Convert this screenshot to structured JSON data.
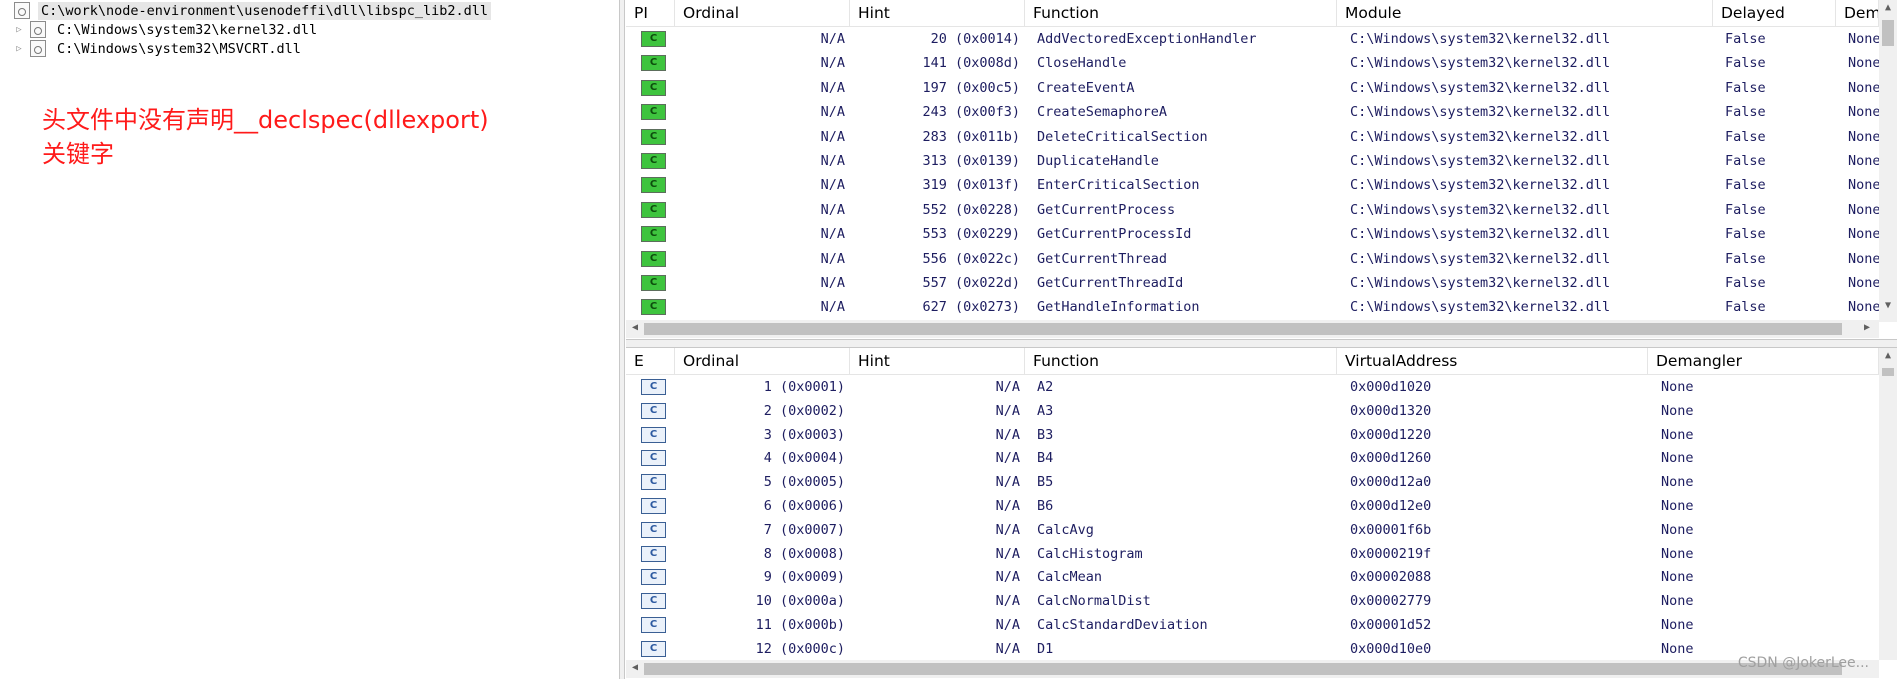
{
  "tree": {
    "items": [
      {
        "label": "C:\\work\\node-environment\\usenodeffi\\dll\\libspc_lib2.dll",
        "selected": true,
        "expander": ""
      },
      {
        "label": "C:\\Windows\\system32\\kernel32.dll",
        "selected": false,
        "expander": "▷"
      },
      {
        "label": "C:\\Windows\\system32\\MSVCRT.dll",
        "selected": false,
        "expander": "▷"
      }
    ]
  },
  "note": {
    "line1": "头文件中没有声明__declspec(dllexport)",
    "line2": "关键字"
  },
  "imports": {
    "columns": [
      "PI",
      "Ordinal",
      "Hint",
      "Function",
      "Module",
      "Delayed",
      "Dem"
    ],
    "icon_label": "C",
    "rows": [
      {
        "ordinal": "N/A",
        "hint": "20 (0x0014)",
        "function": "AddVectoredExceptionHandler",
        "module": "C:\\Windows\\system32\\kernel32.dll",
        "delayed": "False",
        "dem": "None"
      },
      {
        "ordinal": "N/A",
        "hint": "141 (0x008d)",
        "function": "CloseHandle",
        "module": "C:\\Windows\\system32\\kernel32.dll",
        "delayed": "False",
        "dem": "None"
      },
      {
        "ordinal": "N/A",
        "hint": "197 (0x00c5)",
        "function": "CreateEventA",
        "module": "C:\\Windows\\system32\\kernel32.dll",
        "delayed": "False",
        "dem": "None"
      },
      {
        "ordinal": "N/A",
        "hint": "243 (0x00f3)",
        "function": "CreateSemaphoreA",
        "module": "C:\\Windows\\system32\\kernel32.dll",
        "delayed": "False",
        "dem": "None"
      },
      {
        "ordinal": "N/A",
        "hint": "283 (0x011b)",
        "function": "DeleteCriticalSection",
        "module": "C:\\Windows\\system32\\kernel32.dll",
        "delayed": "False",
        "dem": "None"
      },
      {
        "ordinal": "N/A",
        "hint": "313 (0x0139)",
        "function": "DuplicateHandle",
        "module": "C:\\Windows\\system32\\kernel32.dll",
        "delayed": "False",
        "dem": "None"
      },
      {
        "ordinal": "N/A",
        "hint": "319 (0x013f)",
        "function": "EnterCriticalSection",
        "module": "C:\\Windows\\system32\\kernel32.dll",
        "delayed": "False",
        "dem": "None"
      },
      {
        "ordinal": "N/A",
        "hint": "552 (0x0228)",
        "function": "GetCurrentProcess",
        "module": "C:\\Windows\\system32\\kernel32.dll",
        "delayed": "False",
        "dem": "None"
      },
      {
        "ordinal": "N/A",
        "hint": "553 (0x0229)",
        "function": "GetCurrentProcessId",
        "module": "C:\\Windows\\system32\\kernel32.dll",
        "delayed": "False",
        "dem": "None"
      },
      {
        "ordinal": "N/A",
        "hint": "556 (0x022c)",
        "function": "GetCurrentThread",
        "module": "C:\\Windows\\system32\\kernel32.dll",
        "delayed": "False",
        "dem": "None"
      },
      {
        "ordinal": "N/A",
        "hint": "557 (0x022d)",
        "function": "GetCurrentThreadId",
        "module": "C:\\Windows\\system32\\kernel32.dll",
        "delayed": "False",
        "dem": "None"
      },
      {
        "ordinal": "N/A",
        "hint": "627 (0x0273)",
        "function": "GetHandleInformation",
        "module": "C:\\Windows\\system32\\kernel32.dll",
        "delayed": "False",
        "dem": "None"
      }
    ]
  },
  "exports": {
    "columns": [
      "E",
      "Ordinal",
      "Hint",
      "Function",
      "VirtualAddress",
      "Demangler"
    ],
    "icon_label": "C",
    "rows": [
      {
        "ordinal": "1 (0x0001)",
        "hint": "N/A",
        "function": "A2",
        "va": "0x000d1020",
        "dem": "None"
      },
      {
        "ordinal": "2 (0x0002)",
        "hint": "N/A",
        "function": "A3",
        "va": "0x000d1320",
        "dem": "None"
      },
      {
        "ordinal": "3 (0x0003)",
        "hint": "N/A",
        "function": "B3",
        "va": "0x000d1220",
        "dem": "None"
      },
      {
        "ordinal": "4 (0x0004)",
        "hint": "N/A",
        "function": "B4",
        "va": "0x000d1260",
        "dem": "None"
      },
      {
        "ordinal": "5 (0x0005)",
        "hint": "N/A",
        "function": "B5",
        "va": "0x000d12a0",
        "dem": "None"
      },
      {
        "ordinal": "6 (0x0006)",
        "hint": "N/A",
        "function": "B6",
        "va": "0x000d12e0",
        "dem": "None"
      },
      {
        "ordinal": "7 (0x0007)",
        "hint": "N/A",
        "function": "CalcAvg",
        "va": "0x00001f6b",
        "dem": "None"
      },
      {
        "ordinal": "8 (0x0008)",
        "hint": "N/A",
        "function": "CalcHistogram",
        "va": "0x0000219f",
        "dem": "None"
      },
      {
        "ordinal": "9 (0x0009)",
        "hint": "N/A",
        "function": "CalcMean",
        "va": "0x00002088",
        "dem": "None"
      },
      {
        "ordinal": "10 (0x000a)",
        "hint": "N/A",
        "function": "CalcNormalDist",
        "va": "0x00002779",
        "dem": "None"
      },
      {
        "ordinal": "11 (0x000b)",
        "hint": "N/A",
        "function": "CalcStandardDeviation",
        "va": "0x00001d52",
        "dem": "None"
      },
      {
        "ordinal": "12 (0x000c)",
        "hint": "N/A",
        "function": "D1",
        "va": "0x000d10e0",
        "dem": "None"
      }
    ]
  },
  "watermark": "CSDN @JokerLee...",
  "colors": {
    "note": "#ff1a1a",
    "icon_green": "#3ec43e",
    "cell_text": "#1d1d60"
  }
}
